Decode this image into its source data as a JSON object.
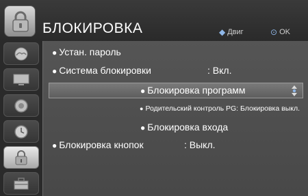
{
  "header": {
    "title": "БЛОКИРОВКА",
    "hint_move": "Двиг",
    "hint_ok": "OK",
    "icon": "lock-category-icon"
  },
  "sidebar": {
    "items": [
      {
        "name": "picture",
        "icon": "picture-icon"
      },
      {
        "name": "screen",
        "icon": "monitor-icon"
      },
      {
        "name": "audio",
        "icon": "speaker-icon"
      },
      {
        "name": "time",
        "icon": "clock-icon"
      },
      {
        "name": "lock",
        "icon": "padlock-icon",
        "active": true
      },
      {
        "name": "option",
        "icon": "toolbox-icon"
      }
    ]
  },
  "menu": {
    "set_password": "Устан. пароль",
    "lock_system": "Система блокировки",
    "lock_system_value": ": Вкл.",
    "program_lock": "Блокировка программ",
    "parental": "Родительский контроль PG: Блокировка выкл.",
    "input_lock": "Блокировка входа",
    "key_lock": "Блокировка кнопок",
    "key_lock_value": ": Выкл."
  },
  "colors": {
    "panel": "#505050",
    "highlight": "#6e6e6e",
    "text": "#ffffff",
    "accent": "#8fb7e8"
  }
}
